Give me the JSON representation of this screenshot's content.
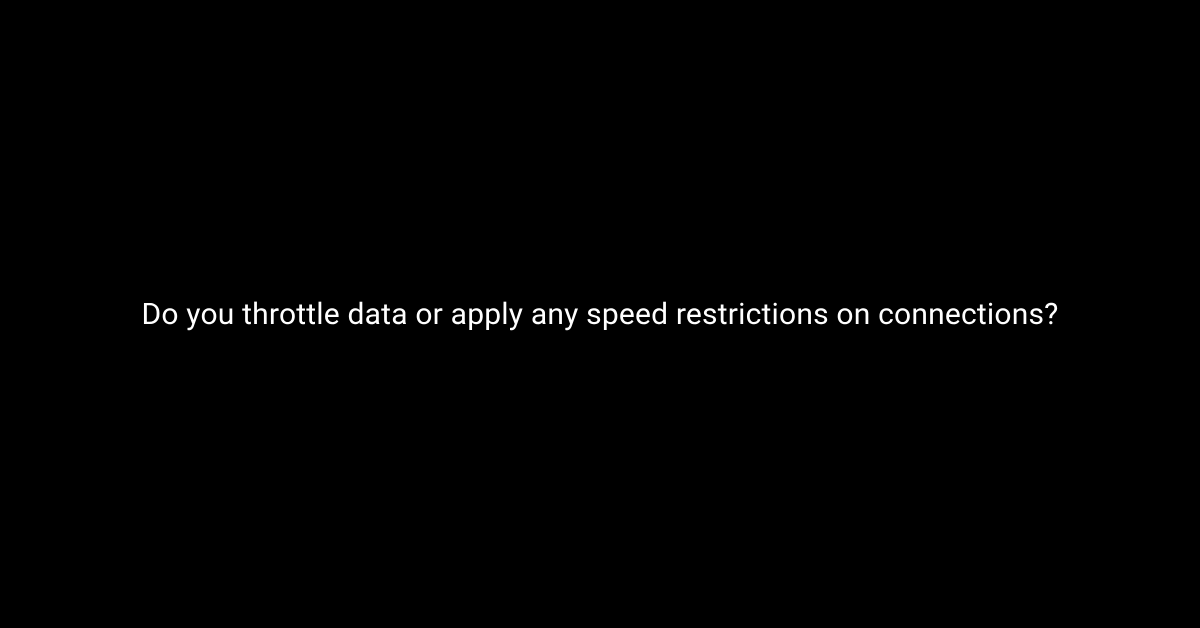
{
  "main": {
    "question": "Do you throttle data or apply any speed restrictions on connections?"
  }
}
